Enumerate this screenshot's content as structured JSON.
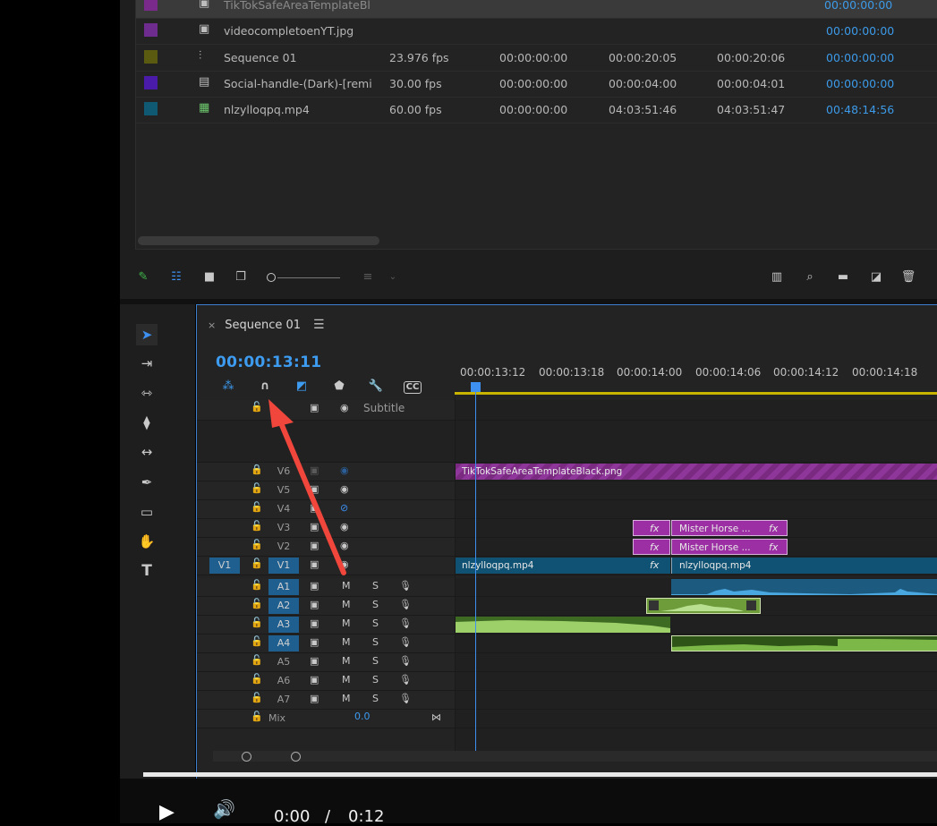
{
  "project_list": {
    "rows": [
      {
        "name": "TikTokSafeAreaTemplateBl",
        "fps": "",
        "start": "",
        "end": "",
        "duration": "",
        "usage": "00:00:00:00",
        "color": "#7a2a8a",
        "icon": "image-icon",
        "selected": true
      },
      {
        "name": "videocompletoenYT.jpg",
        "fps": "",
        "start": "",
        "end": "",
        "duration": "",
        "usage": "00:00:00:00",
        "color": "#6e2d8e",
        "icon": "image-icon",
        "selected": false
      },
      {
        "name": "Sequence 01",
        "fps": "23.976 fps",
        "start": "00:00:00:00",
        "end": "00:00:20:05",
        "duration": "00:00:20:06",
        "usage": "00:00:00:00",
        "color": "#5a5a10",
        "icon": "sequence-icon",
        "selected": false
      },
      {
        "name": "Social-handle-(Dark)-[remi",
        "fps": "30.00 fps",
        "start": "00:00:00:00",
        "end": "00:00:04:00",
        "duration": "00:00:04:01",
        "usage": "00:00:00:00",
        "color": "#4a1aa8",
        "icon": "graphic-icon",
        "selected": false
      },
      {
        "name": "nlzylloqpq.mp4",
        "fps": "60.00 fps",
        "start": "00:00:00:00",
        "end": "04:03:51:46",
        "duration": "04:03:51:47",
        "usage": "00:48:14:56",
        "color": "#0f5a72",
        "icon": "video-icon",
        "selected": false
      }
    ]
  },
  "timeline": {
    "tab_title": "Sequence 01",
    "close": "×",
    "menu": "☰",
    "timecode": "00:00:13:11",
    "ruler_labels": [
      "00:00:13:12",
      "00:00:13:18",
      "00:00:14:00",
      "00:00:14:06",
      "00:00:14:12",
      "00:00:14:18"
    ],
    "subtitle_label": "Subtitle",
    "source_patch": "V1",
    "video_tracks": [
      "V6",
      "V5",
      "V4",
      "V3",
      "V2",
      "V1"
    ],
    "audio_tracks": [
      "A1",
      "A2",
      "A3",
      "A4",
      "A5",
      "A6",
      "A7"
    ],
    "mute": "M",
    "solo": "S",
    "mix_label": "Mix",
    "mix_value": "0.0",
    "fx": "fx",
    "clips": {
      "v6": "TikTokSafeAreaTemplateBlack.png",
      "v3": "Mister Horse ...",
      "v2": "Mister Horse ...",
      "v1a": "nlzylloqpq.mp4",
      "v1b": "nlzylloqpq.mp4"
    }
  },
  "player": {
    "time_current": "0:00",
    "time_separator": "/",
    "time_total": "0:12"
  },
  "colors": {
    "accent": "#3d9bf0",
    "arrow": "#f0463c",
    "playhead": "#3d8ff0"
  }
}
